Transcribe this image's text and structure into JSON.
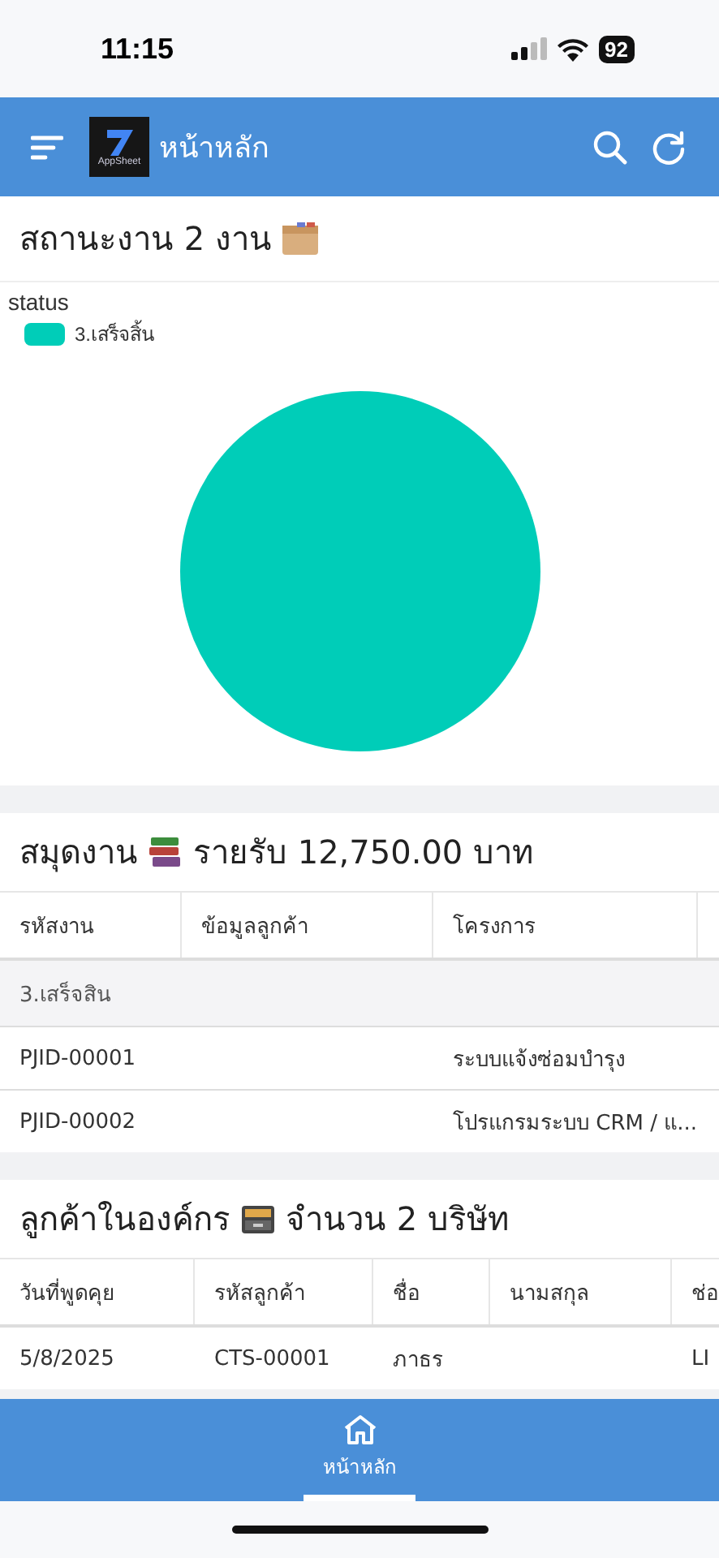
{
  "status_bar": {
    "time": "11:15",
    "battery": "92"
  },
  "app_bar": {
    "logo_text": "AppSheet",
    "title": "หน้าหลัก"
  },
  "status_card": {
    "title": "สถานะงาน 2 งาน",
    "chart_data": {
      "type": "pie",
      "categories": [
        "3.เสร็จสิ้น"
      ],
      "series": [
        {
          "name": "status",
          "color": "#00cdb8",
          "values": [
            100
          ]
        }
      ]
    }
  },
  "jobs_card": {
    "title": "สมุดงาน",
    "title_suffix": "รายรับ 12,750.00 บาท",
    "columns": [
      "รหัสงาน",
      "ข้อมูลลูกค้า",
      "โครงการ"
    ],
    "group": "3.เสร็จสิน",
    "rows": [
      {
        "cells": [
          "PJID-00001",
          "",
          "ระบบแจ้งซ่อมบำรุง"
        ]
      },
      {
        "cells": [
          "PJID-00002",
          "",
          "โปรแกรมระบบ CRM / แ..."
        ]
      }
    ]
  },
  "customers_card": {
    "title": "ลูกค้าในองค์กร",
    "title_suffix": "จำนวน 2 บริษัท",
    "columns": [
      "วันที่พูดคุย",
      "รหัสลูกค้า",
      "ชื่อ",
      "นามสกุล",
      "ช่อ"
    ],
    "rows": [
      {
        "cells": [
          "5/8/2025",
          "CTS-00001",
          "ภาธร",
          "",
          "LI"
        ]
      }
    ]
  },
  "bottom_nav": [
    {
      "label": "หน้าหลัก",
      "selected": true
    }
  ]
}
